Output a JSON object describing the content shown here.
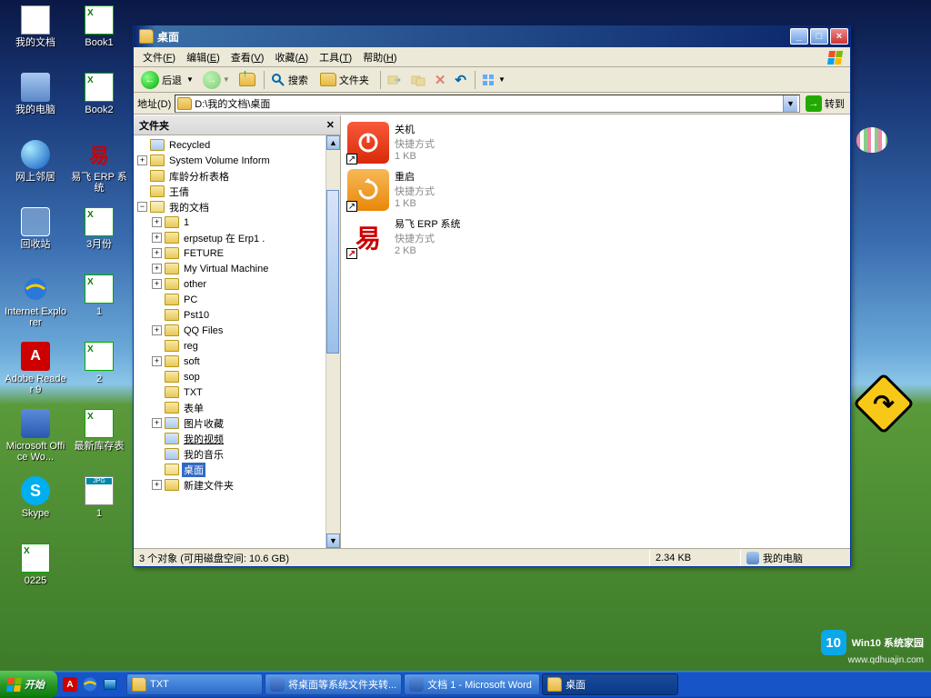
{
  "desktop_icons": [
    {
      "label": "我的文档",
      "icon": "doc"
    },
    {
      "label": "我的电脑",
      "icon": "comp"
    },
    {
      "label": "网上邻居",
      "icon": "net"
    },
    {
      "label": "回收站",
      "icon": "recyc"
    },
    {
      "label": "Internet Explorer",
      "icon": "ie"
    },
    {
      "label": "Adobe Reader 9",
      "icon": "pdf"
    },
    {
      "label": "Microsoft Office Wo...",
      "icon": "word"
    },
    {
      "label": "Skype",
      "icon": "skype"
    },
    {
      "label": "0225",
      "icon": "xls"
    },
    {
      "label": "Book1",
      "icon": "xls"
    },
    {
      "label": "Book2",
      "icon": "xls"
    },
    {
      "label": "易飞 ERP 系统",
      "icon": "red"
    },
    {
      "label": "3月份",
      "icon": "xls"
    },
    {
      "label": "1",
      "icon": "xls"
    },
    {
      "label": "2",
      "icon": "xls"
    },
    {
      "label": "最新库存表",
      "icon": "xls"
    },
    {
      "label": "1",
      "icon": "jpg"
    }
  ],
  "window": {
    "title": "桌面",
    "menus": [
      {
        "t": "文件",
        "u": "F"
      },
      {
        "t": "编辑",
        "u": "E"
      },
      {
        "t": "查看",
        "u": "V"
      },
      {
        "t": "收藏",
        "u": "A"
      },
      {
        "t": "工具",
        "u": "T"
      },
      {
        "t": "帮助",
        "u": "H"
      }
    ],
    "toolbar": {
      "back": "后退",
      "search": "搜索",
      "folders": "文件夹"
    },
    "address": {
      "label": "地址(D)",
      "value": "D:\\我的文档\\桌面",
      "go": "转到"
    },
    "folder_pane": {
      "title": "文件夹"
    },
    "tree": {
      "recycled": "Recycled",
      "svi": "System Volume Inform",
      "kl": "库龄分析表格",
      "wq": "王倩",
      "mydoc": "我的文档",
      "children": [
        {
          "l": "1",
          "e": "+"
        },
        {
          "l": "erpsetup 在 Erp1 .",
          "e": "+"
        },
        {
          "l": "FETURE",
          "e": "+"
        },
        {
          "l": "My Virtual Machine",
          "e": "+"
        },
        {
          "l": "other",
          "e": "+"
        },
        {
          "l": "PC",
          "e": ""
        },
        {
          "l": "Pst10",
          "e": ""
        },
        {
          "l": "QQ Files",
          "e": "+"
        },
        {
          "l": "reg",
          "e": ""
        },
        {
          "l": "soft",
          "e": "+"
        },
        {
          "l": "sop",
          "e": ""
        },
        {
          "l": "TXT",
          "e": ""
        },
        {
          "l": "表单",
          "e": ""
        },
        {
          "l": "图片收藏",
          "e": "+",
          "spec": true
        },
        {
          "l": "我的视频",
          "e": "",
          "spec": true,
          "und": true
        },
        {
          "l": "我的音乐",
          "e": "",
          "spec": true
        },
        {
          "l": "桌面",
          "e": "",
          "sel": true,
          "open": true
        },
        {
          "l": "新建文件夹",
          "e": "+"
        }
      ]
    },
    "items": [
      {
        "name": "关机",
        "type": "快捷方式",
        "size": "1 KB",
        "icon": "shutdown"
      },
      {
        "name": "重启",
        "type": "快捷方式",
        "size": "1 KB",
        "icon": "restart"
      },
      {
        "name": "易飞 ERP 系统",
        "type": "快捷方式",
        "size": "2 KB",
        "icon": "erp"
      }
    ],
    "status": {
      "left": "3 个对象 (可用磁盘空间: 10.6 GB)",
      "size": "2.34 KB",
      "loc": "我的电脑"
    }
  },
  "taskbar": {
    "start": "开始",
    "tasks": [
      {
        "label": "TXT",
        "icon": "folder"
      },
      {
        "label": "将桌面等系统文件夹转...",
        "icon": "word"
      },
      {
        "label": "文档 1 - Microsoft Word",
        "icon": "word"
      },
      {
        "label": "桌面",
        "icon": "folder",
        "active": true
      }
    ]
  },
  "watermark": {
    "big": "Win10 系统家园",
    "small": "www.qdhuajin.com",
    "badge": "10"
  }
}
